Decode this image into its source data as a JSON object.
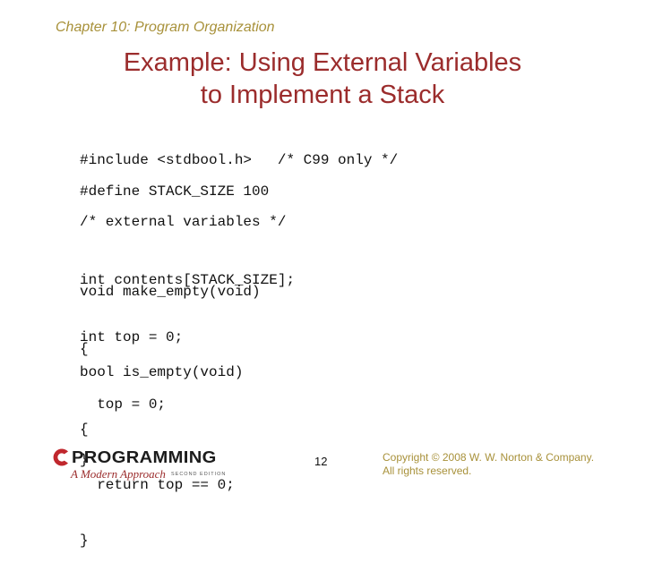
{
  "slide": {
    "chapter": "Chapter 10: Program Organization",
    "title_line1": "Example: Using External Variables",
    "title_line2": "to Implement a Stack",
    "code": {
      "include_line": "#include <stdbool.h>   /* C99 only */",
      "define_line": "#define STACK_SIZE 100",
      "vars": [
        "/* external variables */",
        "int contents[STACK_SIZE];",
        "int top = 0;"
      ],
      "make_empty": [
        "void make_empty(void)",
        "{",
        "  top = 0;",
        "}"
      ],
      "is_empty": [
        "bool is_empty(void)",
        "{",
        "  return top == 0;",
        "}"
      ]
    },
    "footer": {
      "logo": {
        "letter": "C",
        "word": "PROGRAMMING",
        "subtitle": "A Modern Approach",
        "edition": "SECOND EDITION"
      },
      "page_number": "12",
      "copyright_line1": "Copyright © 2008 W. W. Norton & Company.",
      "copyright_line2": "All rights reserved."
    },
    "colors": {
      "title": "#9b2c2c",
      "chapter": "#a8913a",
      "logo_red": "#c0272d"
    }
  }
}
